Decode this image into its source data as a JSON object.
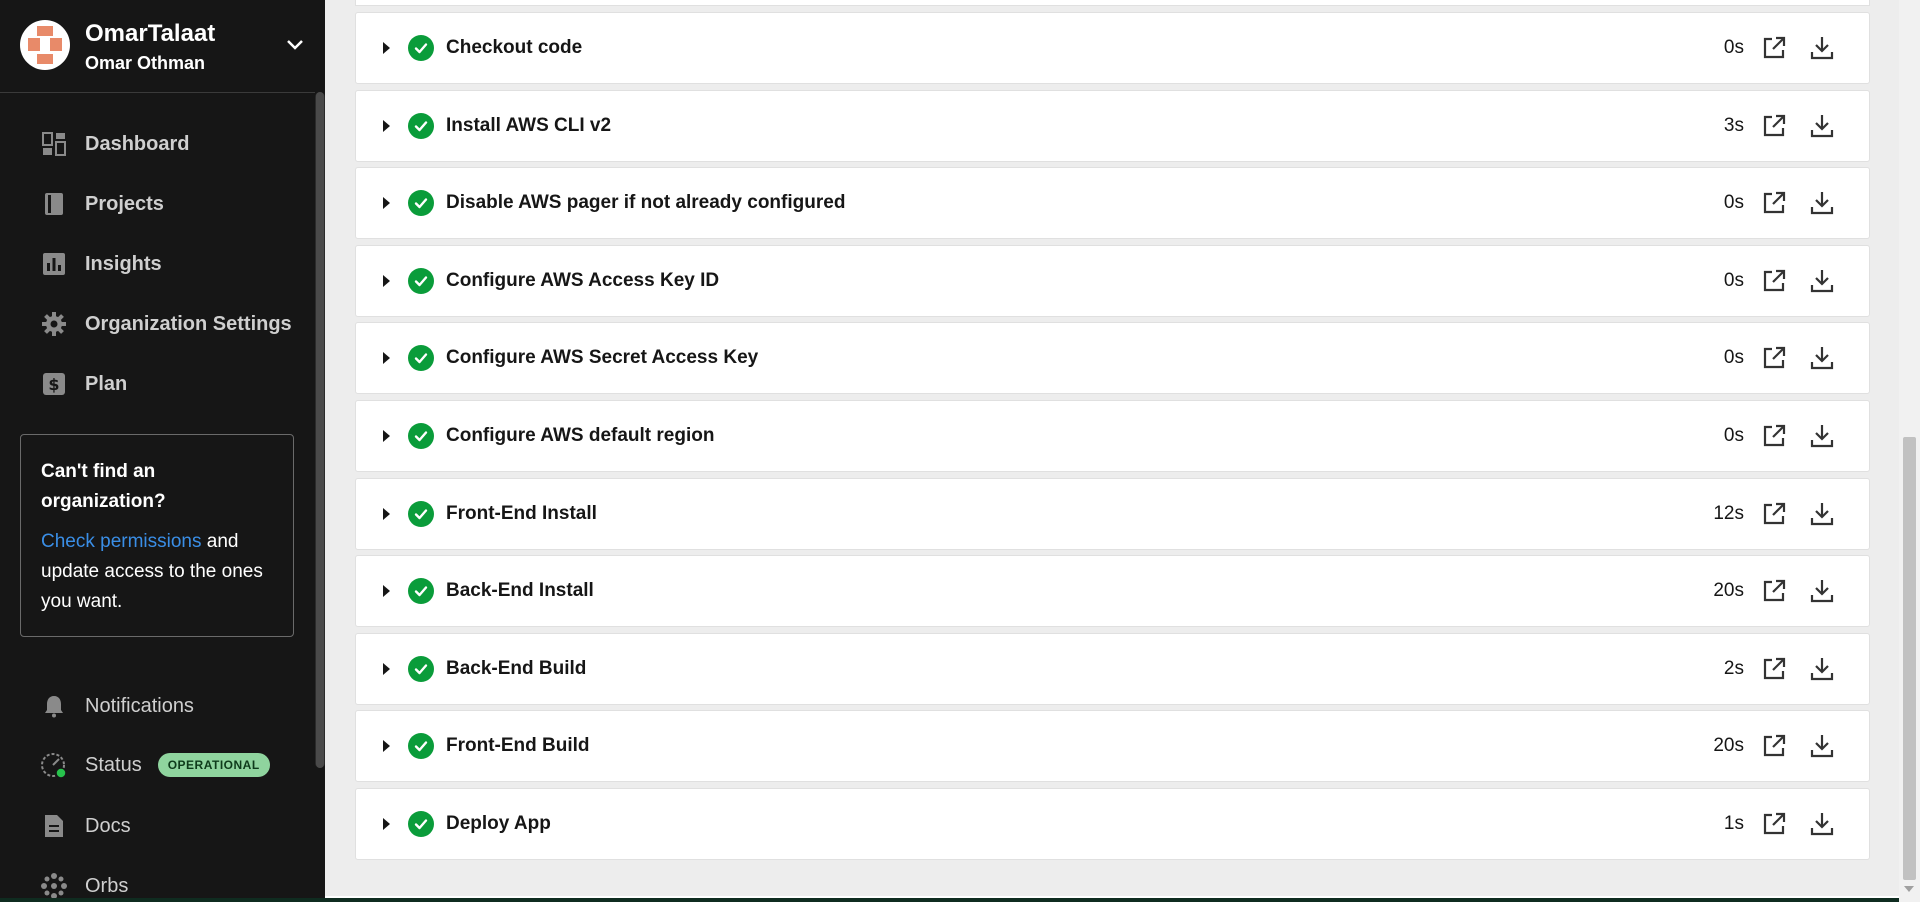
{
  "org": {
    "name": "OmarTalaat",
    "user": "Omar Othman"
  },
  "nav": {
    "items": [
      {
        "label": "Dashboard",
        "icon": "dashboard-icon"
      },
      {
        "label": "Projects",
        "icon": "projects-icon"
      },
      {
        "label": "Insights",
        "icon": "insights-icon"
      },
      {
        "label": "Organization Settings",
        "icon": "gear-icon"
      },
      {
        "label": "Plan",
        "icon": "dollar-icon"
      }
    ],
    "secondary": [
      {
        "label": "Notifications",
        "icon": "bell-icon"
      },
      {
        "label": "Status",
        "icon": "status-icon",
        "badge": "OPERATIONAL"
      },
      {
        "label": "Docs",
        "icon": "document-icon"
      },
      {
        "label": "Orbs",
        "icon": "orbs-icon"
      }
    ]
  },
  "cant_find": {
    "title": "Can't find an organization?",
    "link": "Check permissions",
    "text": " and update access to the ones you want."
  },
  "steps": [
    {
      "name": "Checkout code",
      "duration": "0s"
    },
    {
      "name": "Install AWS CLI v2",
      "duration": "3s"
    },
    {
      "name": "Disable AWS pager if not already configured",
      "duration": "0s"
    },
    {
      "name": "Configure AWS Access Key ID",
      "duration": "0s"
    },
    {
      "name": "Configure AWS Secret Access Key",
      "duration": "0s"
    },
    {
      "name": "Configure AWS default region",
      "duration": "0s"
    },
    {
      "name": "Front-End Install",
      "duration": "12s"
    },
    {
      "name": "Back-End Install",
      "duration": "20s"
    },
    {
      "name": "Back-End Build",
      "duration": "2s"
    },
    {
      "name": "Front-End Build",
      "duration": "20s"
    },
    {
      "name": "Deploy App",
      "duration": "1s"
    }
  ],
  "colors": {
    "sidebar_bg": "#161616",
    "success": "#0a9c3a",
    "link": "#3a8ee6",
    "badge_bg": "#8fd49e"
  }
}
